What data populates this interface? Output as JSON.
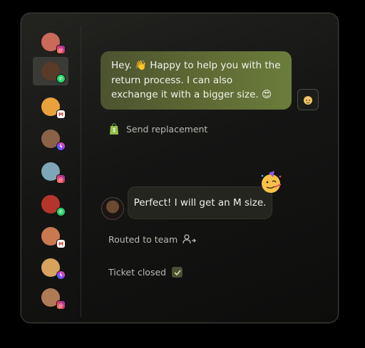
{
  "sidebar": {
    "contacts": [
      {
        "id": "c1",
        "channel": "instagram",
        "avatar_color": "#c96a5a"
      },
      {
        "id": "c2",
        "channel": "whatsapp",
        "avatar_color": "#5a3b28",
        "active": true
      },
      {
        "id": "c3",
        "channel": "gmail",
        "avatar_color": "#e9a23b"
      },
      {
        "id": "c4",
        "channel": "messenger",
        "avatar_color": "#8a6248"
      },
      {
        "id": "c5",
        "channel": "instagram",
        "avatar_color": "#7ea6b6"
      },
      {
        "id": "c6",
        "channel": "whatsapp",
        "avatar_color": "#b5352d"
      },
      {
        "id": "c7",
        "channel": "gmail",
        "avatar_color": "#c9794f"
      },
      {
        "id": "c8",
        "channel": "messenger",
        "avatar_color": "#d7a15e"
      },
      {
        "id": "c9",
        "channel": "instagram",
        "avatar_color": "#b07a55"
      }
    ]
  },
  "conversation": {
    "agent_message": "Hey. 👋 Happy to help you with the return process. I can also exchange it with a bigger size. 😍",
    "send_replacement_label": "Send replacement",
    "customer_message": "Perfect! I will get an M size.",
    "routed_label": "Routed to team",
    "ticket_closed_label": "Ticket closed"
  },
  "colors": {
    "accent_green": "#6b7d3c",
    "shopify_green": "#95bf47"
  },
  "icons": {
    "send_replacement": "shopify-bag-icon",
    "routed": "user-arrow-icon",
    "ticket_closed": "checkmark-icon",
    "reaction": "party-face-emoji"
  }
}
